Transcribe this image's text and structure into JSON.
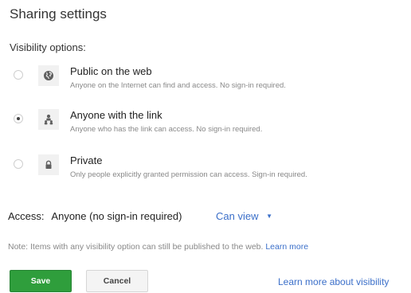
{
  "dialog": {
    "title": "Sharing settings",
    "visibility_label": "Visibility options:"
  },
  "options": [
    {
      "title": "Public on the web",
      "description": "Anyone on the Internet can find and access. No sign-in required.",
      "icon": "globe-icon",
      "selected": false
    },
    {
      "title": "Anyone with the link",
      "description": "Anyone who has the link can access. No sign-in required.",
      "icon": "people-icon",
      "selected": true
    },
    {
      "title": "Private",
      "description": "Only people explicitly granted permission can access. Sign-in required.",
      "icon": "lock-icon",
      "selected": false
    }
  ],
  "access": {
    "label": "Access:",
    "value": "Anyone (no sign-in required)",
    "permission": "Can view",
    "caret": "▼"
  },
  "note": {
    "text": "Note: Items with any visibility option can still be published to the web.",
    "link": "Learn more"
  },
  "buttons": {
    "save": "Save",
    "cancel": "Cancel"
  },
  "footer": {
    "link": "Learn more about visibility"
  },
  "colors": {
    "save_button": "#2f9e3c",
    "link": "#3b6fc9"
  }
}
